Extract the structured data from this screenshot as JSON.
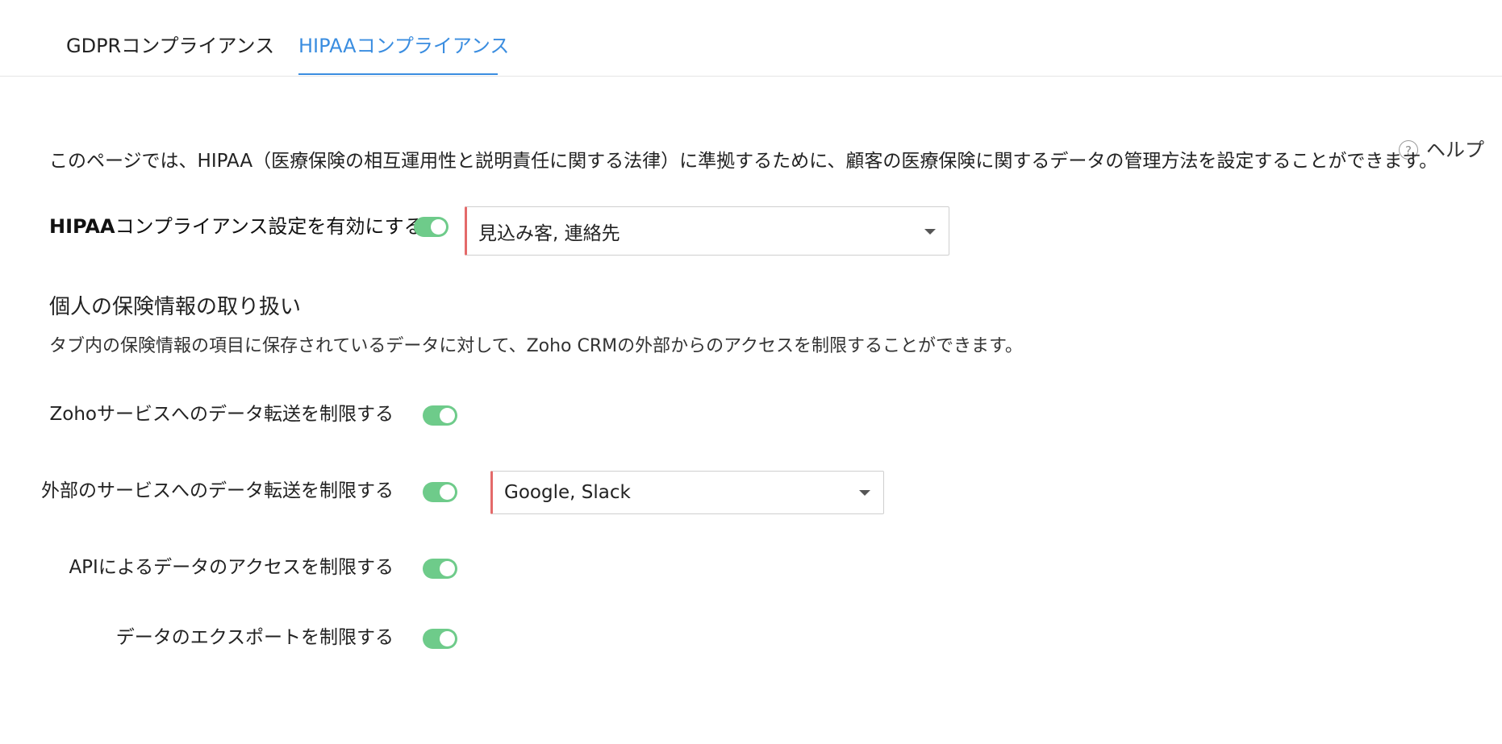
{
  "tabs": [
    {
      "label": "GDPRコンプライアンス",
      "active": false
    },
    {
      "label": "HIPAAコンプライアンス",
      "active": true
    }
  ],
  "help": {
    "icon": "question-icon",
    "icon_glyph": "?",
    "label": "ヘルプ"
  },
  "description": "このページでは、HIPAA（医療保険の相互運用性と説明責任に関する法律）に準拠するために、顧客の医療保険に関するデータの管理方法を設定することができます。",
  "enable": {
    "label_bold": "HIPAA",
    "label_rest": "コンプライアンス設定を有効にする",
    "enabled": true,
    "selected_modules": "見込み客, 連絡先"
  },
  "section": {
    "title": "個人の保険情報の取り扱い",
    "description": "タブ内の保険情報の項目に保存されているデータに対して、Zoho CRMの外部からのアクセスを制限することができます。"
  },
  "restrictions": [
    {
      "label": "Zohoサービスへのデータ転送を制限する",
      "enabled": true
    },
    {
      "label": "外部のサービスへのデータ転送を制限する",
      "enabled": true,
      "selected_services": "Google, Slack"
    },
    {
      "label": "APIによるデータのアクセスを制限する",
      "enabled": true
    },
    {
      "label": "データのエクスポートを制限する",
      "enabled": true
    }
  ],
  "colors": {
    "accent": "#3a8de0",
    "toggle_on": "#6ecb8a",
    "required_marker": "#e46a6a"
  }
}
